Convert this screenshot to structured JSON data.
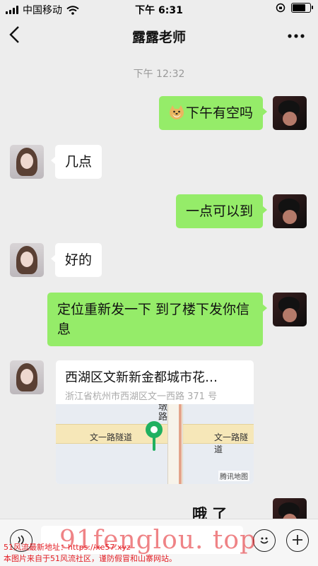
{
  "status_bar": {
    "carrier": "中国移动",
    "time": "下午 6:31",
    "battery_level": 0.85
  },
  "nav": {
    "title": "露露老师",
    "back_icon": "chevron-left-icon",
    "more_icon": "more-dots-icon"
  },
  "chat": {
    "timestamp": "下午 12:32",
    "messages": [
      {
        "sender": "me",
        "text": "下午有空吗",
        "emoji": "doge-emoji"
      },
      {
        "sender": "her",
        "text": "几点"
      },
      {
        "sender": "me",
        "text": "一点可以到"
      },
      {
        "sender": "her",
        "text": "好的"
      },
      {
        "sender": "me",
        "text": "定位重新发一下 到了楼下发你信息"
      }
    ],
    "location": {
      "title": "西湖区文新新金都城市花…",
      "address": "浙江省杭州市西湖区文一西路 371 号",
      "map_labels": {
        "road_left": "文一路隧道",
        "road_right": "文一路隧道",
        "road_vertical": "墩路",
        "brand": "腾讯地图"
      }
    },
    "partial_message": "哦 了"
  },
  "input_bar": {
    "voice_icon": "voice-icon",
    "emoji_icon": "emoji-icon",
    "plus_icon": "plus-icon"
  },
  "watermarks": {
    "big": "91fenglou. top",
    "line1": "51风流最新地址：https://xe57.xyz",
    "line2": "本图片来自于51风流社区，谨防假冒和山寨网站。"
  },
  "colors": {
    "my_bubble": "#95ec69",
    "her_bubble": "#ffffff",
    "background": "#ededed",
    "watermark": "#e31e24",
    "pin": "#20b060"
  }
}
